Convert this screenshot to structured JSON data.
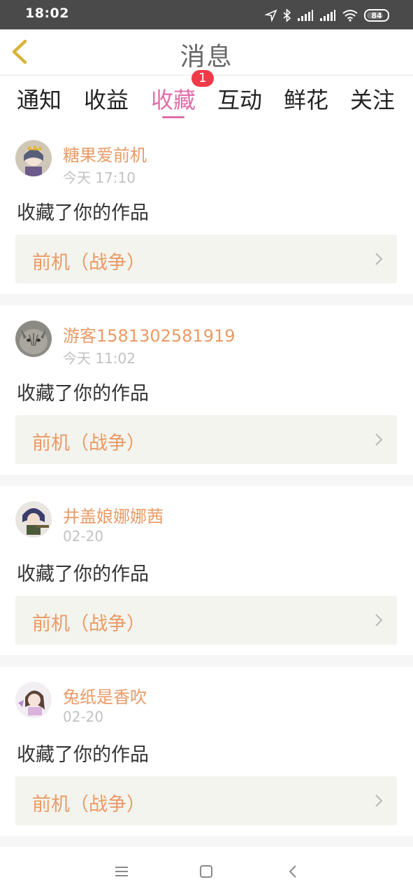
{
  "status_bar": {
    "time": "18:02",
    "battery": "84"
  },
  "header": {
    "title": "消息"
  },
  "tabs": [
    {
      "label": "通知"
    },
    {
      "label": "收益"
    },
    {
      "label": "收藏",
      "badge": "1"
    },
    {
      "label": "互动"
    },
    {
      "label": "鲜花"
    },
    {
      "label": "关注"
    }
  ],
  "items": [
    {
      "user": "糖果爱前机",
      "time": "今天 17:10",
      "action": "收藏了你的作品",
      "work": "前机（战争）"
    },
    {
      "user": "游客1581302581919",
      "time": "今天 11:02",
      "action": "收藏了你的作品",
      "work": "前机（战争）"
    },
    {
      "user": "井盖娘娜娜茜",
      "time": "02-20",
      "action": "收藏了你的作品",
      "work": "前机（战争）"
    },
    {
      "user": "兔纸是香吹",
      "time": "02-20",
      "action": "收藏了你的作品",
      "work": "前机（战争）"
    }
  ],
  "colors": {
    "accent": "#e06fa8",
    "username": "#ea9a66",
    "badge": "#f03a4a"
  }
}
